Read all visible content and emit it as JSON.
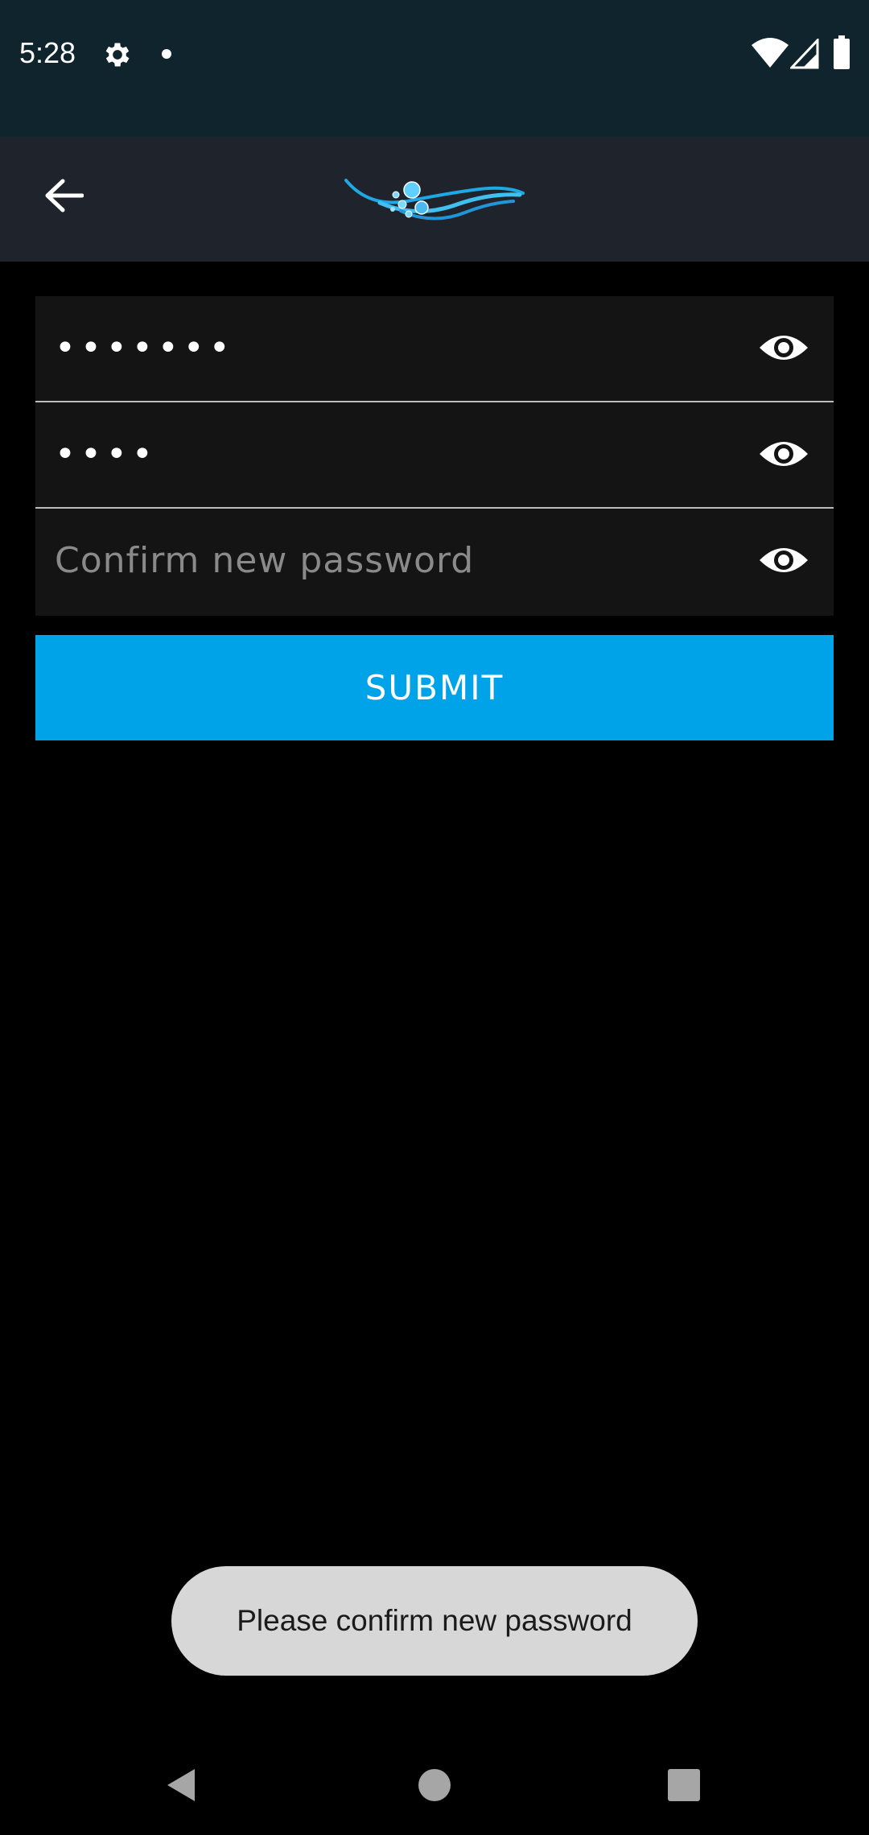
{
  "status_bar": {
    "time": "5:28",
    "icons": [
      "gear-icon",
      "notification-dot-icon",
      "wifi-icon",
      "cell-signal-icon",
      "battery-icon"
    ]
  },
  "app_bar": {
    "back_icon": "arrow-back-icon",
    "logo": "wave-bubbles-logo"
  },
  "form": {
    "fields": [
      {
        "value": "•••••••",
        "placeholder": "",
        "toggle_icon": "eye-icon"
      },
      {
        "value": "••••",
        "placeholder": "",
        "toggle_icon": "eye-icon"
      },
      {
        "value": "",
        "placeholder": "Confirm new password",
        "toggle_icon": "eye-icon"
      }
    ],
    "submit_label": "SUBMIT"
  },
  "toast": {
    "message": "Please confirm new password"
  },
  "nav_bar": {
    "icons": [
      "nav-back-icon",
      "nav-home-icon",
      "nav-recents-icon"
    ]
  },
  "colors": {
    "status_bar_bg": "#0f242c",
    "app_bar_bg": "#1e232c",
    "field_bg": "#141414",
    "accent": "#00a3e8",
    "toast_bg": "#d7d7d7"
  }
}
